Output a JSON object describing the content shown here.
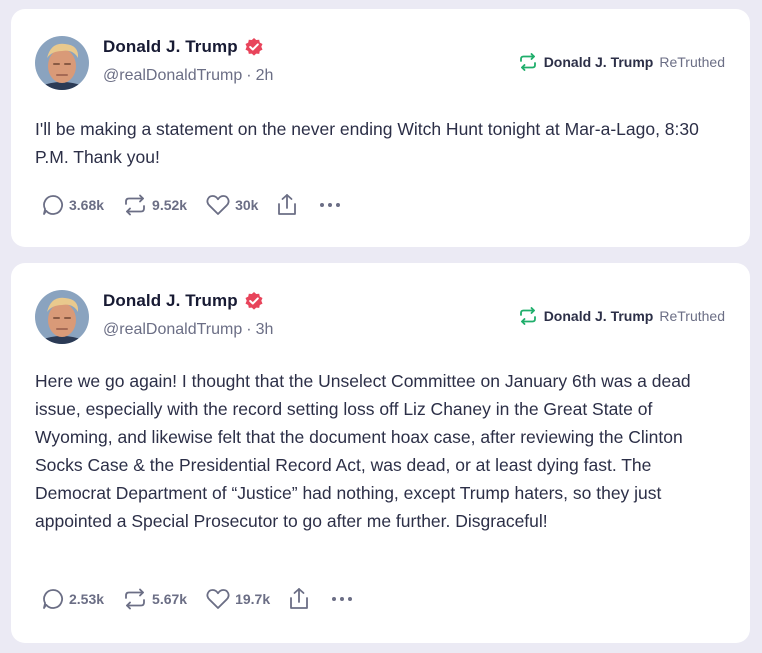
{
  "colors": {
    "background": "#ebeaf4",
    "card": "#ffffff",
    "verified": "#e8445b",
    "retruth_green": "#1fae6b",
    "muted": "#6b6e85",
    "text": "#171a33"
  },
  "posts": [
    {
      "author": "Donald J. Trump",
      "handle": "@realDonaldTrump",
      "separator": "·",
      "time": "2h",
      "retruth": {
        "icon": "retruth-icon",
        "name": "Donald J. Trump",
        "label": "ReTruthed"
      },
      "text": "I'll be making a statement on the never ending Witch Hunt tonight at Mar-a-Lago, 8:30 P.M. Thank you!",
      "actions": {
        "replies": "3.68k",
        "retruths": "9.52k",
        "likes": "30k"
      }
    },
    {
      "author": "Donald J. Trump",
      "handle": "@realDonaldTrump",
      "separator": "·",
      "time": "3h",
      "retruth": {
        "icon": "retruth-icon",
        "name": "Donald J. Trump",
        "label": "ReTruthed"
      },
      "text": "Here we go again! I thought that the Unselect Committee on January 6th was a dead issue, especially with the record setting loss off Liz Chaney in the Great State of Wyoming, and likewise felt that the document hoax case, after reviewing the Clinton Socks Case & the Presidential Record Act, was dead, or at least dying fast. The Democrat Department of “Justice” had nothing, except Trump haters, so they just appointed a Special Prosecutor to go after me further. Disgraceful!",
      "actions": {
        "replies": "2.53k",
        "retruths": "5.67k",
        "likes": "19.7k"
      }
    }
  ]
}
